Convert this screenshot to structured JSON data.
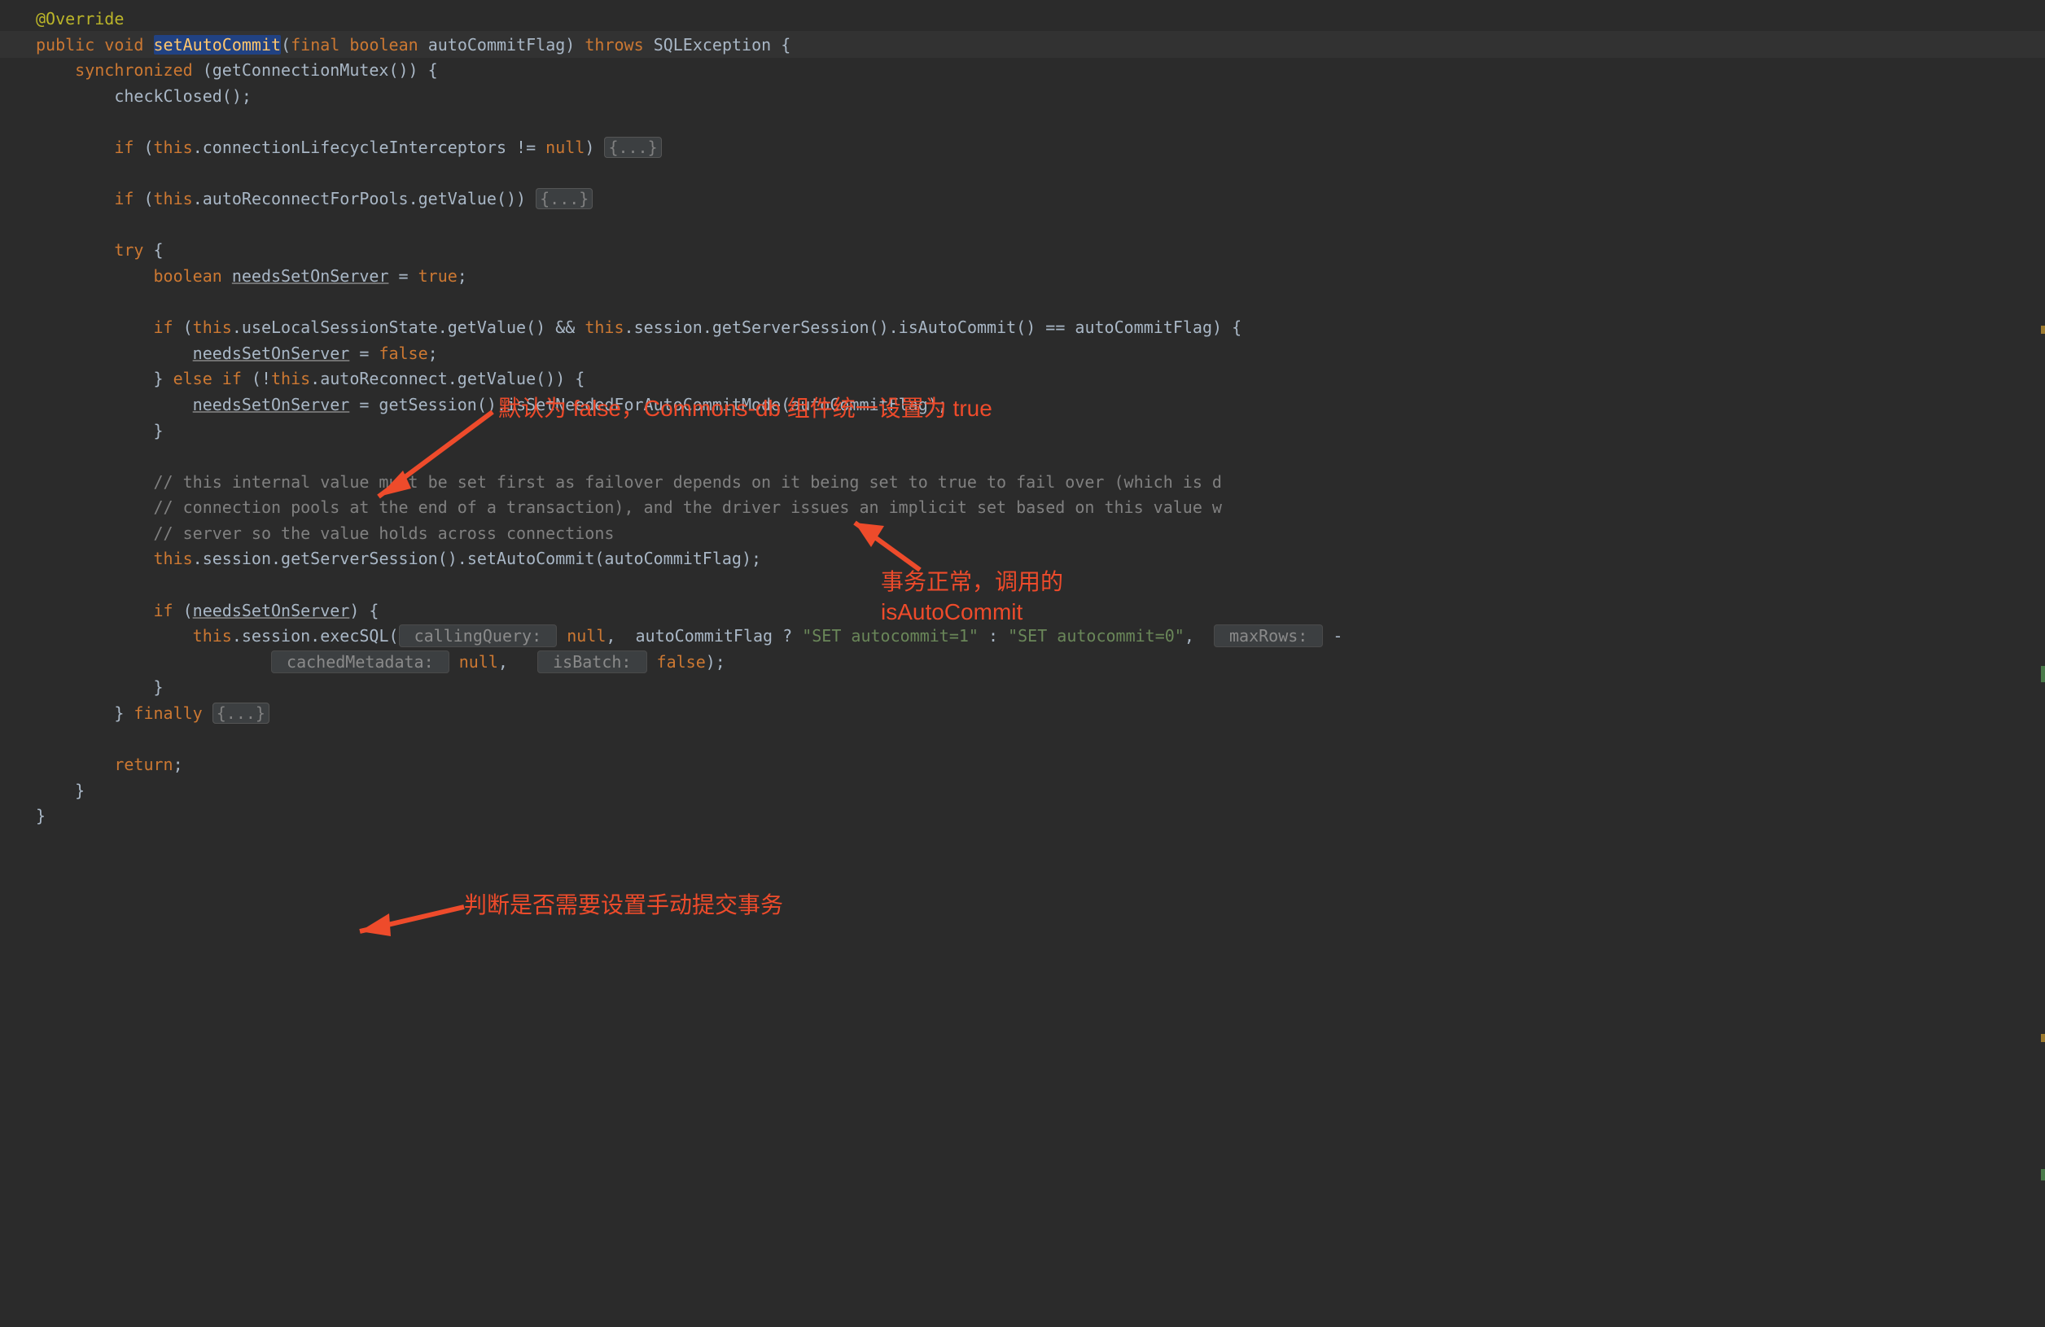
{
  "code": {
    "annotation": "@Override",
    "kw_public": "public",
    "kw_void": "void",
    "method": "setAutoCommit",
    "sig_open": "(",
    "kw_final": "final",
    "kw_boolean": "boolean",
    "param": "autoCommitFlag",
    "sig_close": ")",
    "kw_throws": "throws",
    "exc": "SQLException",
    "brace_open": " {",
    "sync_line": "    synchronized (getConnectionMutex()) {",
    "checkClosed": "        checkClosed();",
    "if1": "        if (",
    "this1": "this",
    "dot": ".",
    "intercept": "connectionLifecycleInterceptors ",
    "neq_null": "!= ",
    "null": "null",
    "paren_close": ")",
    "fold": "{...}",
    "if2": "        if (",
    "autorec": "autoReconnectForPools.getValue())",
    "try": "        try {",
    "bool_decl": "            boolean ",
    "needs": "needsSetOnServer",
    "assign_true": " = ",
    "true": "true",
    "semi": ";",
    "if3": "            if (",
    "uls": "useLocalSessionState.getValue()",
    "andand": " && ",
    "sess": "session.getServerSession().isAutoCommit() == autoCommitFlag) {",
    "needs_false": "                ",
    "eq_false": " = ",
    "false": "false",
    "elseif": "            } ",
    "kw_else": "else",
    "kw_if": " if",
    "notauto": " (!",
    "autoRec": "autoReconnect.getValue()) {",
    "needs_calc": "                ",
    "calc": " = getSession().isSetNeededForAutoCommitMode(autoCommitFlag);",
    "close_if": "            }",
    "c1": "            // this internal value must be set first as failover depends on it being set to true to fail over (which is d",
    "c2": "            // connection pools at the end of a transaction), and the driver issues an implicit set based on this value w",
    "c3": "            // server so the value holds across connections",
    "setline": "            ",
    "setcall": "session.getServerSession().setAutoCommit(autoCommitFlag);",
    "if4": "            if (",
    "needs_if": "needsSetOnServer",
    "if4_close": ") {",
    "exec_pre": "                ",
    "exec_this": "this",
    "exec_sess": ".session.execSQL(",
    "hint_cq": " callingQuery: ",
    "exec_null1": "null",
    "comma": ",  ",
    "exec_flag": "autoCommitFlag ? ",
    "str1": "\"SET autocommit=1\"",
    "tern": " : ",
    "str0": "\"SET autocommit=0\"",
    "exec_comma2": ",  ",
    "hint_mr": " maxRows: ",
    "exec_neg": "-",
    "exec_line2_pad": "                        ",
    "hint_cm": " cachedMetadata: ",
    "exec_null2": "null",
    "exec_comma3": ",   ",
    "hint_ib": " isBatch: ",
    "exec_false": "false",
    "exec_end": ");",
    "close_exec": "            }",
    "finally_line": "        } ",
    "kw_finally": "finally",
    "return": "        return;",
    "close_sync": "    }",
    "close_method": "}"
  },
  "annotations": {
    "a1": "默认为 false，Commons-db 组件统一设置为 true",
    "a2_line1": "事务正常，调用的",
    "a2_line2": "isAutoCommit",
    "a3": "判断是否需要设置手动提交事务"
  }
}
